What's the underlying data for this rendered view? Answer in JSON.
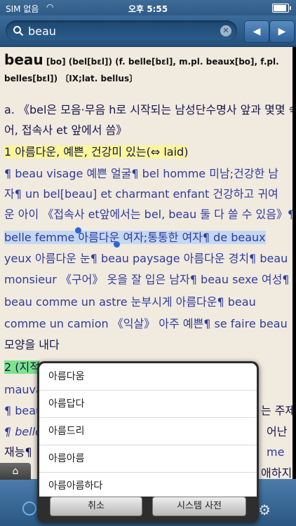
{
  "status": {
    "carrier": "SIM 없음",
    "time": "오후 5:55"
  },
  "search": {
    "query": "beau"
  },
  "nav": {
    "prev_symbol": "◀",
    "next_symbol": "▶"
  },
  "entry": {
    "headword": "beau",
    "phonetics": "[bo] (bel[bɛl]) (f. belle[bɛl], m.pl. beaux[bo], f.pl. belles[bɛl]) 〔IX;lat. bellus〕",
    "lines": [
      "a. 《bel은 모음·무음 h로 시작되는 남성단수명사 앞과 몇몇 숙",
      "어, 접속사 et 앞에서 씀》",
      "1 아름다운, 예쁜, 건강미 있는(⇔ laid)",
      "¶ beau visage 예쁜 얼굴¶ bel homme 미남;건강한 남",
      "자¶ un bel[beau] et charmant enfant 건강하고 귀여",
      "운 아이 《접속사 et앞에서는 bel, beau 둘 다 쓸 수 있음》¶",
      "belle femme 아름다운 여자;통통한 여자¶ de beaux",
      "yeux 아름다운 눈¶ beau paysage 아름다운 경치¶ beau",
      "monsieur 《구어》 옷을 잘 입은 남자¶ beau sexe 여성¶",
      "beau comme un astre 눈부시게 아름다운¶ beau",
      "comme un camion 《익살》 아주 예쁜¶ se faire beau",
      "모양을 내다",
      "2 (지적",
      "mauva",
      "¶ beau",
      "¶ belle",
      "재능¶",
      "",
      "¶"
    ],
    "right_fragments": [
      "는 주제",
      "어난",
      "me",
      "애하지"
    ]
  },
  "suggestions": [
    "아름다움",
    "아름답다",
    "아름드리",
    "아름아름",
    "아름아름하다"
  ],
  "buttons": {
    "cancel": "취소",
    "system_dictionary": "시스템 사전"
  },
  "icons": {
    "home": "home-icon",
    "settings": "gear-icon",
    "clear": "clear-icon"
  }
}
